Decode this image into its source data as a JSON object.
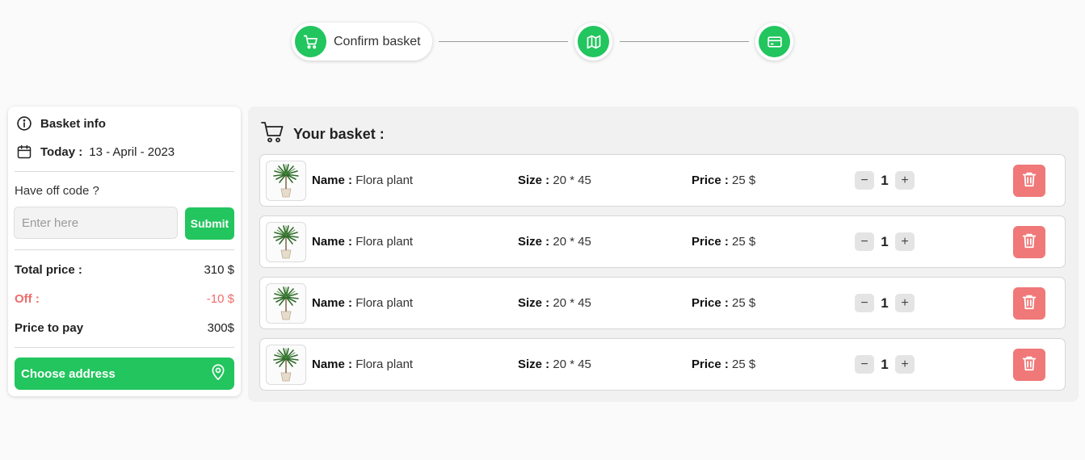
{
  "colors": {
    "accent": "#22c55e",
    "danger": "#f07878",
    "discount": "#ef6b6b"
  },
  "stepper": {
    "steps": [
      {
        "label": "Confirm basket",
        "icon": "cart-icon",
        "active": true
      },
      {
        "label": "",
        "icon": "map-icon",
        "active": false
      },
      {
        "label": "",
        "icon": "credit-card-icon",
        "active": false
      }
    ]
  },
  "info": {
    "title": "Basket info",
    "today_label": "Today :",
    "date": "13 - April - 2023",
    "off_code_label": "Have off code ?",
    "off_code_placeholder": "Enter here",
    "off_code_value": "",
    "submit_label": "Submit",
    "total_label": "Total price :",
    "total_value": "310 $",
    "off_label": "Off :",
    "off_value": "-10 $",
    "pay_label": "Price to pay",
    "pay_value": "300$",
    "choose_address_label": "Choose address"
  },
  "basket": {
    "title": "Your basket :",
    "items": [
      {
        "name_label": "Name :",
        "name": "Flora plant",
        "size_label": "Size :",
        "size": "20 * 45",
        "price_label": "Price :",
        "price": "25 $",
        "qty": "1",
        "minus": "−",
        "plus": "+"
      },
      {
        "name_label": "Name :",
        "name": "Flora plant",
        "size_label": "Size :",
        "size": "20 * 45",
        "price_label": "Price :",
        "price": "25 $",
        "qty": "1",
        "minus": "−",
        "plus": "+"
      },
      {
        "name_label": "Name :",
        "name": "Flora plant",
        "size_label": "Size :",
        "size": "20 * 45",
        "price_label": "Price :",
        "price": "25 $",
        "qty": "1",
        "minus": "−",
        "plus": "+"
      },
      {
        "name_label": "Name :",
        "name": "Flora plant",
        "size_label": "Size :",
        "size": "20 * 45",
        "price_label": "Price :",
        "price": "25 $",
        "qty": "1",
        "minus": "−",
        "plus": "+"
      }
    ]
  }
}
